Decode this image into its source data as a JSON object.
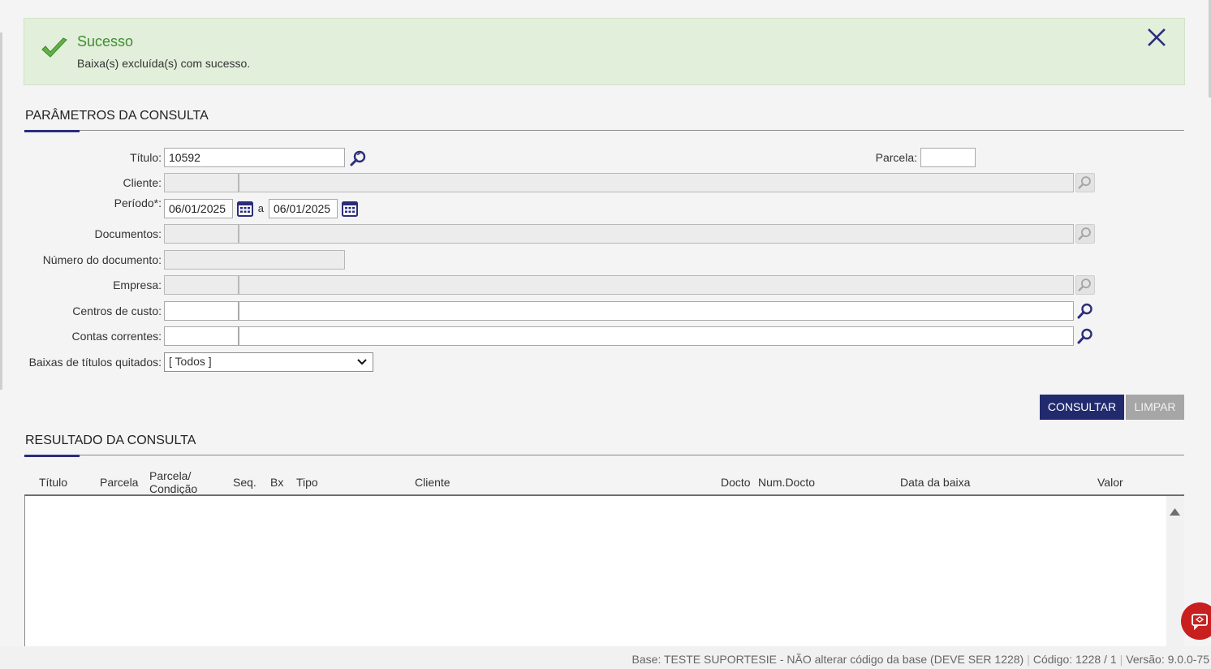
{
  "alert": {
    "title": "Sucesso",
    "message": "Baixa(s) excluída(s) com sucesso.",
    "color_success": "#3f8d32"
  },
  "params": {
    "section_title": "PARÂMETROS DA CONSULTA",
    "titulo_label": "Título:",
    "titulo_value": "10592",
    "parcela_label": "Parcela:",
    "parcela_value": "",
    "cliente_label": "Cliente:",
    "periodo_label": "Período*:",
    "periodo_from": "06/01/2025",
    "periodo_sep": "a",
    "periodo_to": "06/01/2025",
    "documentos_label": "Documentos:",
    "numero_documento_label": "Número do documento:",
    "empresa_label": "Empresa:",
    "centros_label": "Centros de custo:",
    "contas_label": "Contas correntes:",
    "baixas_label": "Baixas de títulos quitados:",
    "baixas_selected": "[ Todos ]"
  },
  "actions": {
    "consultar": "CONSULTAR",
    "limpar": "LIMPAR",
    "accent_color": "#222a6e"
  },
  "results": {
    "section_title": "RESULTADO DA CONSULTA",
    "columns": {
      "titulo": "Título",
      "parcela": "Parcela",
      "parcela_condicao_1": "Parcela/",
      "parcela_condicao_2": "Condição",
      "seq": "Seq.",
      "bx": "Bx",
      "tipo": "Tipo",
      "cliente": "Cliente",
      "docto": "Docto",
      "num_docto": "Num.Docto",
      "data_baixa": "Data da baixa",
      "valor": "Valor"
    },
    "rows": []
  },
  "footer": {
    "base": "Base: TESTE SUPORTESIE - NÃO alterar código da base (DEVE SER 1228)",
    "codigo": "Código: 1228 / 1",
    "versao": "Versão: 9.0.0-75"
  },
  "icons": {
    "check": "check-icon",
    "close": "close-icon",
    "search": "search-icon",
    "calendar": "calendar-icon",
    "chat": "chat-icon"
  }
}
